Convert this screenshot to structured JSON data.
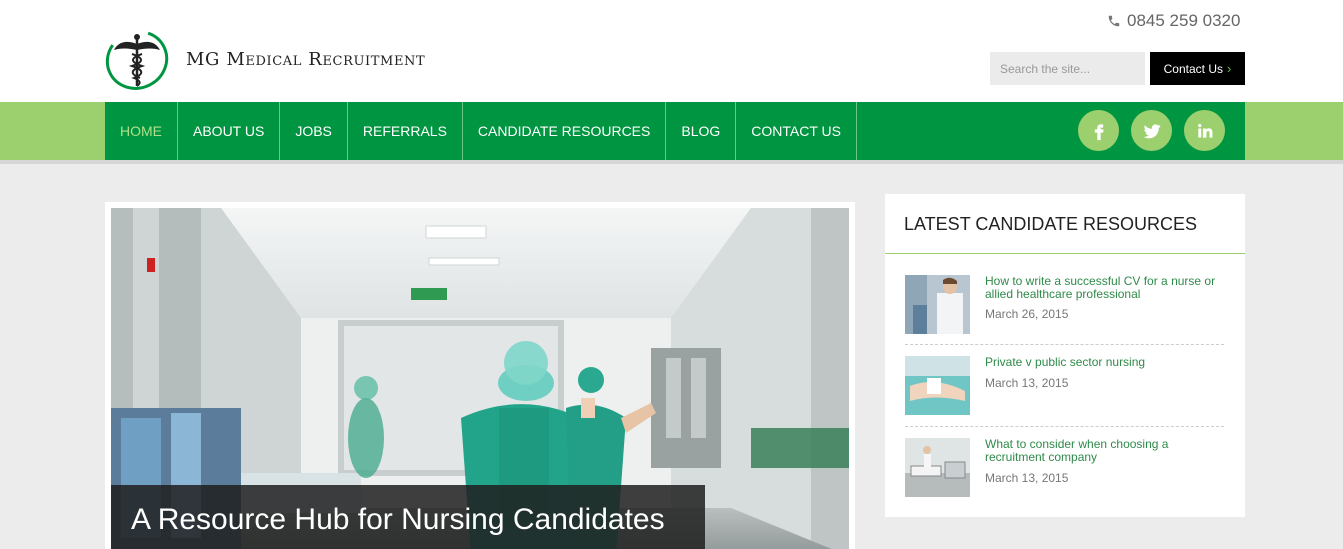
{
  "header": {
    "brand": "MG Medical Recruitment",
    "phone": "0845 259 0320",
    "search_placeholder": "Search the site...",
    "contact_label": "Contact Us"
  },
  "nav": {
    "items": [
      {
        "label": "HOME",
        "active": true
      },
      {
        "label": "ABOUT US"
      },
      {
        "label": "JOBS"
      },
      {
        "label": "REFERRALS"
      },
      {
        "label": "CANDIDATE RESOURCES"
      },
      {
        "label": "BLOG"
      },
      {
        "label": "CONTACT US"
      }
    ],
    "social": [
      "facebook-icon",
      "twitter-icon",
      "linkedin-icon"
    ]
  },
  "hero": {
    "caption": "A Resource Hub for Nursing Candidates"
  },
  "sidebar": {
    "title": "LATEST CANDIDATE RESOURCES",
    "items": [
      {
        "title": "How to write a successful CV for a nurse or allied healthcare professional",
        "date": "March 26, 2015"
      },
      {
        "title": "Private v public sector nursing",
        "date": "March 13, 2015"
      },
      {
        "title": "What to consider when choosing a recruitment company",
        "date": "March 13, 2015"
      }
    ]
  },
  "colors": {
    "brand_green": "#009540",
    "light_green": "#9ccf6e",
    "link_green": "#2f8a4a"
  }
}
